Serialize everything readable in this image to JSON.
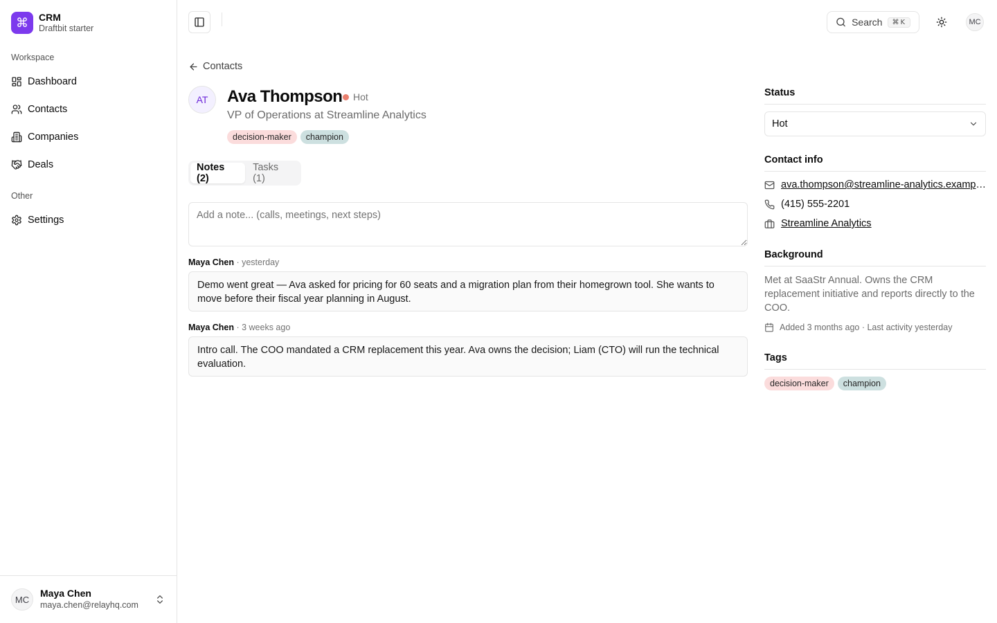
{
  "brand": {
    "logo_glyph": "⌘",
    "name": "CRM",
    "subtitle": "Draftbit starter",
    "accent": "#7c3aed"
  },
  "sidebar": {
    "workspace_label": "Workspace",
    "items": [
      {
        "label": "Dashboard",
        "icon": "dashboard-icon"
      },
      {
        "label": "Contacts",
        "icon": "users-icon"
      },
      {
        "label": "Companies",
        "icon": "building-icon"
      },
      {
        "label": "Deals",
        "icon": "handshake-icon"
      }
    ],
    "other_label": "Other",
    "other_items": [
      {
        "label": "Settings",
        "icon": "gear-icon"
      }
    ],
    "user": {
      "initials": "MC",
      "name": "Maya Chen",
      "email": "maya.chen@relayhq.com"
    }
  },
  "topbar": {
    "search_label": "Search",
    "search_shortcut": "⌘K",
    "avatar_initials": "MC"
  },
  "contact": {
    "back_label": "Contacts",
    "initials": "AT",
    "name": "Ava Thompson",
    "status": "Hot",
    "status_color": "#e97f6e",
    "title": "VP of Operations at Streamline Analytics",
    "tags": [
      "decision-maker",
      "champion"
    ]
  },
  "tabs": [
    {
      "label": "Notes (2)",
      "active": true
    },
    {
      "label": "Tasks (1)",
      "active": false
    }
  ],
  "note_input": {
    "placeholder": "Add a note... (calls, meetings, next steps)"
  },
  "notes": [
    {
      "author": "Maya Chen",
      "time": " · yesterday",
      "text": "Demo went great — Ava asked for pricing for 60 seats and a migration plan from their homegrown tool. She wants to move before their fiscal year planning in August."
    },
    {
      "author": "Maya Chen",
      "time": " · 3 weeks ago",
      "text": "Intro call. The COO mandated a CRM replacement this year. Ava owns the decision; Liam (CTO) will run the technical evaluation."
    }
  ],
  "panel": {
    "status_heading": "Status",
    "status_value": "Hot",
    "contact_heading": "Contact info",
    "email": "ava.thompson@streamline-analytics.example.com",
    "phone": "(415) 555-2201",
    "company": "Streamline Analytics",
    "background_heading": "Background",
    "background_text": "Met at SaaStr Annual. Owns the CRM replacement initiative and reports directly to the COO.",
    "added_text": "Added 3 months ago · Last activity yesterday",
    "tags_heading": "Tags",
    "tags": [
      "decision-maker",
      "champion"
    ]
  }
}
